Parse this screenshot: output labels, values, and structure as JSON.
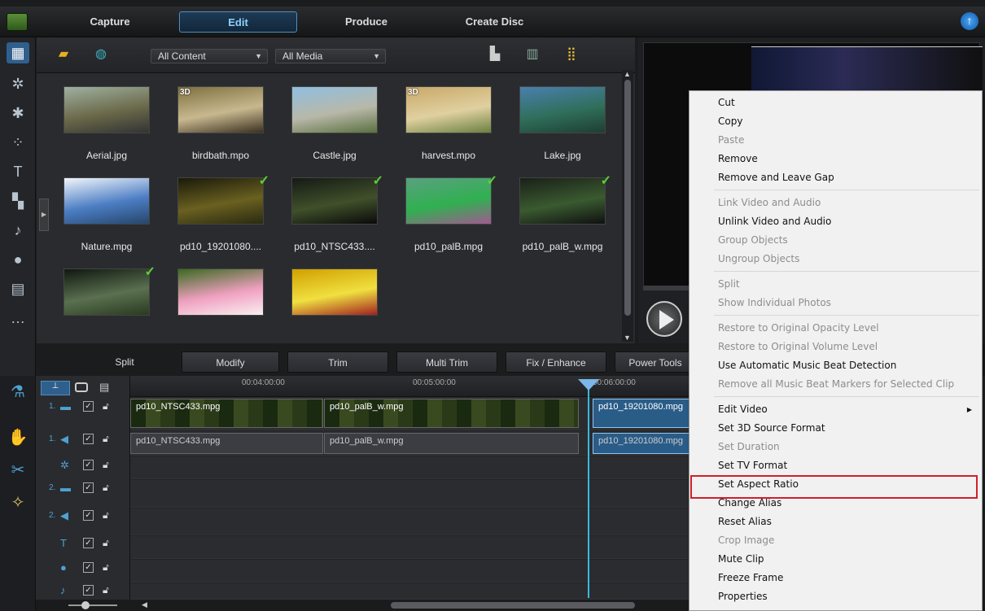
{
  "top_nav": {
    "tabs": [
      "Capture",
      "Edit",
      "Produce",
      "Create Disc"
    ],
    "active": "Edit"
  },
  "library": {
    "filter_content": "All Content",
    "filter_media": "All Media",
    "items": [
      {
        "name": "Aerial.jpg",
        "is3d": false,
        "used": false,
        "colors": [
          "#9fb0a0",
          "#6b6a4a",
          "#333"
        ]
      },
      {
        "name": "birdbath.mpo",
        "is3d": true,
        "used": false,
        "colors": [
          "#7f7040",
          "#c8b88f",
          "#3a3020"
        ]
      },
      {
        "name": "Castle.jpg",
        "is3d": false,
        "used": false,
        "colors": [
          "#8fbfe0",
          "#b8b8a8",
          "#5a7040"
        ]
      },
      {
        "name": "harvest.mpo",
        "is3d": true,
        "used": false,
        "colors": [
          "#c8a868",
          "#e0d0a0",
          "#6a8040"
        ]
      },
      {
        "name": "Lake.jpg",
        "is3d": false,
        "used": false,
        "colors": [
          "#4a7fae",
          "#2f6f5a",
          "#1e3d33"
        ]
      },
      {
        "name": "Nature.mpg",
        "is3d": false,
        "used": false,
        "colors": [
          "#f1f5fb",
          "#4c7ec4",
          "#26466b"
        ]
      },
      {
        "name": "pd10_19201080....",
        "is3d": false,
        "used": true,
        "colors": [
          "#1a1a0a",
          "#6a6020",
          "#2a2a10"
        ]
      },
      {
        "name": "pd10_NTSC433....",
        "is3d": false,
        "used": true,
        "colors": [
          "#151a15",
          "#40502a",
          "#0a0a0a"
        ]
      },
      {
        "name": "pd10_palB.mpg",
        "is3d": false,
        "used": true,
        "colors": [
          "#5aa080",
          "#30b050",
          "#a05a90"
        ]
      },
      {
        "name": "pd10_palB_w.mpg",
        "is3d": false,
        "used": true,
        "colors": [
          "#1a2018",
          "#3a5a30",
          "#101010"
        ]
      },
      {
        "name": "",
        "is3d": false,
        "used": true,
        "colors": [
          "#101810",
          "#5a7050",
          "#2a3a20"
        ]
      },
      {
        "name": "",
        "is3d": false,
        "used": false,
        "colors": [
          "#3a6a20",
          "#f0a0c0",
          "#f8f0f0"
        ]
      },
      {
        "name": "",
        "is3d": false,
        "used": false,
        "colors": [
          "#d0a000",
          "#f0e040",
          "#a02020"
        ]
      }
    ]
  },
  "edit_toolbar": [
    "Split",
    "Modify",
    "Trim",
    "Multi Trim",
    "Fix / Enhance",
    "Power Tools"
  ],
  "timeline": {
    "ticks": [
      "00:04:00:00",
      "00:05:00:00",
      "00:06:00:00"
    ],
    "track_numbers": [
      "1.",
      "1.",
      "",
      "2.",
      "2.",
      "",
      "",
      ""
    ],
    "video_clips": [
      "pd10_NTSC433.mpg",
      "pd10_palB_w.mpg",
      "pd10_19201080.mpg"
    ],
    "audio_clips": [
      "pd10_NTSC433.mpg",
      "pd10_palB_w.mpg",
      "pd10_19201080.mpg"
    ]
  },
  "context_menu": {
    "items": [
      {
        "label": "Cut",
        "disabled": false
      },
      {
        "label": "Copy",
        "disabled": false
      },
      {
        "label": "Paste",
        "disabled": true
      },
      {
        "label": "Remove",
        "disabled": false
      },
      {
        "label": "Remove and Leave Gap",
        "disabled": false
      },
      {
        "sep": true
      },
      {
        "label": "Link Video and Audio",
        "disabled": true
      },
      {
        "label": "Unlink Video and Audio",
        "disabled": false
      },
      {
        "label": "Group Objects",
        "disabled": true
      },
      {
        "label": "Ungroup Objects",
        "disabled": true
      },
      {
        "sep": true
      },
      {
        "label": "Split",
        "disabled": true
      },
      {
        "label": "Show Individual Photos",
        "disabled": true
      },
      {
        "sep": true
      },
      {
        "label": "Restore to Original Opacity Level",
        "disabled": true
      },
      {
        "label": "Restore to Original Volume Level",
        "disabled": true
      },
      {
        "label": "Use Automatic Music Beat Detection",
        "disabled": false
      },
      {
        "label": "Remove all Music Beat Markers for Selected Clip",
        "disabled": true
      },
      {
        "sep": true
      },
      {
        "label": "Edit Video",
        "disabled": false,
        "submenu": true
      },
      {
        "label": "Set 3D Source Format",
        "disabled": false
      },
      {
        "label": "Set Duration",
        "disabled": true
      },
      {
        "label": "Set TV Format",
        "disabled": false
      },
      {
        "label": "Set Aspect Ratio",
        "disabled": false,
        "highlighted": true
      },
      {
        "label": "Change Alias",
        "disabled": false
      },
      {
        "label": "Reset Alias",
        "disabled": false
      },
      {
        "label": "Crop Image",
        "disabled": true
      },
      {
        "label": "Mute Clip",
        "disabled": false
      },
      {
        "label": "Freeze Frame",
        "disabled": false
      },
      {
        "label": "Properties",
        "disabled": false
      }
    ]
  }
}
